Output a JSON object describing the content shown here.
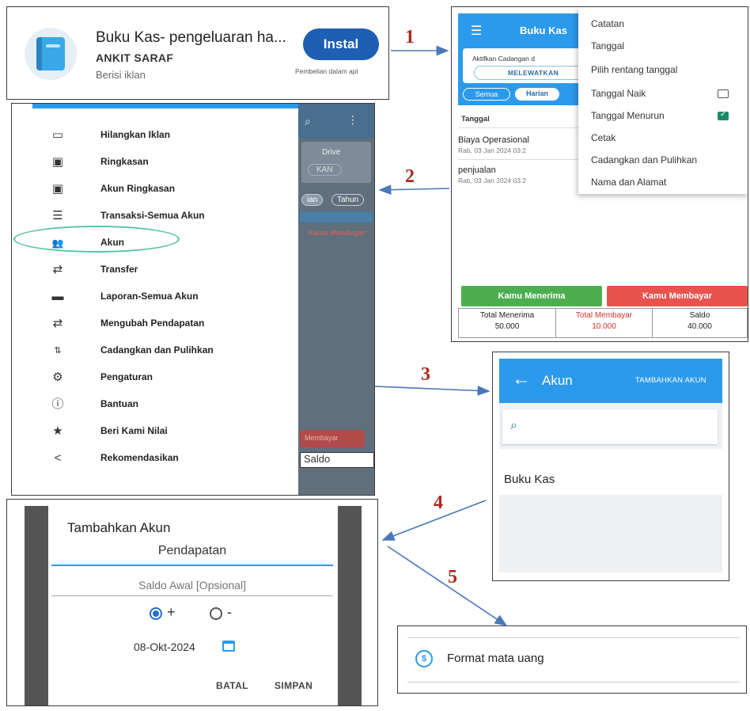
{
  "install_card": {
    "title": "Buku Kas- pengeluaran ha...",
    "developer": "ANKIT SARAF",
    "ads_note": "Berisi iklan",
    "install_button": "Instal",
    "in_app_purchases": "Pembelian dalam apl"
  },
  "bukukas_screen": {
    "title": "Buku Kas",
    "backup_prompt": "Aktifkan Cadangan d",
    "skip_button": "MELEWATKAN",
    "chip_all": "Semua",
    "chip_daily": "Harian",
    "column_header": "Tanggal",
    "entries": [
      {
        "title": "Biaya Operasional",
        "date": "Rab, 03 Jan 2024 03:2"
      },
      {
        "title": "penjualan",
        "date": "Rab, 03 Jan 2024 03:2"
      }
    ],
    "receive_button": "Kamu Menerima",
    "pay_button": "Kamu Membayar",
    "summary": [
      {
        "label": "Total Menerima",
        "value": "50.000",
        "color": "#333333"
      },
      {
        "label": "Total Membayar",
        "value": "10.000",
        "color": "#d0312d"
      },
      {
        "label": "Saldo",
        "value": "40.000",
        "color": "#333333"
      }
    ],
    "overflow_menu": [
      {
        "label": "Catatan"
      },
      {
        "label": "Tanggal"
      },
      {
        "label": "Pilih rentang tanggal"
      },
      {
        "label": "Tanggal Naik",
        "checkbox": false
      },
      {
        "label": "Tanggal Menurun",
        "checkbox": true
      },
      {
        "label": "Cetak"
      },
      {
        "label": "Cadangkan dan Pulihkan"
      },
      {
        "label": "Nama dan Alamat"
      }
    ]
  },
  "drawer": {
    "items": [
      {
        "icon": "calendar-icon",
        "label": "Hilangkan Iklan"
      },
      {
        "icon": "clipboard-icon",
        "label": "Ringkasan"
      },
      {
        "icon": "clipboard-icon",
        "label": "Akun Ringkasan"
      },
      {
        "icon": "list-icon",
        "label": "Transaksi-Semua Akun"
      },
      {
        "icon": "people-icon",
        "label": "Akun"
      },
      {
        "icon": "transfer-icon",
        "label": "Transfer"
      },
      {
        "icon": "folder-icon",
        "label": "Laporan-Semua Akun"
      },
      {
        "icon": "transfer-icon",
        "label": "Mengubah Pendapatan"
      },
      {
        "icon": "sort-icon",
        "label": "Cadangkan dan Pulihkan"
      },
      {
        "icon": "gear-icon",
        "label": "Pengaturan"
      },
      {
        "icon": "help-icon",
        "label": "Bantuan"
      },
      {
        "icon": "star-icon",
        "label": "Beri Kami Nilai"
      },
      {
        "icon": "share-icon",
        "label": "Rekomendasikan"
      }
    ],
    "background": {
      "drive_text": "Drive",
      "skip_text": "KAN",
      "chip_1": "ian",
      "chip_2": "Tahun",
      "pay_header": "Kamu Membayar",
      "pay_chip": "Membayar",
      "saldo": "Saldo"
    }
  },
  "akun_screen": {
    "title": "Akun",
    "add_button": "TAMBAHKAN AKUN",
    "account_name": "Buku Kas"
  },
  "add_account_dialog": {
    "title": "Tambahkan Akun",
    "name_value": "Pendapatan",
    "balance_placeholder": "Saldo Awal [Opsional]",
    "radio_plus": "+",
    "radio_minus": "-",
    "date": "08-Okt-2024",
    "cancel_button": "BATAL",
    "save_button": "SIMPAN"
  },
  "format_panel": {
    "label": "Format mata uang"
  },
  "steps": [
    "1",
    "2",
    "3",
    "4",
    "5"
  ],
  "colors": {
    "accent_blue": "#2b9aec",
    "step_red": "#a92b1e",
    "arrow_blue": "#4a78b8",
    "receive_green": "#4cae4f",
    "pay_red": "#e8534d",
    "highlight_green": "#57c79a"
  }
}
